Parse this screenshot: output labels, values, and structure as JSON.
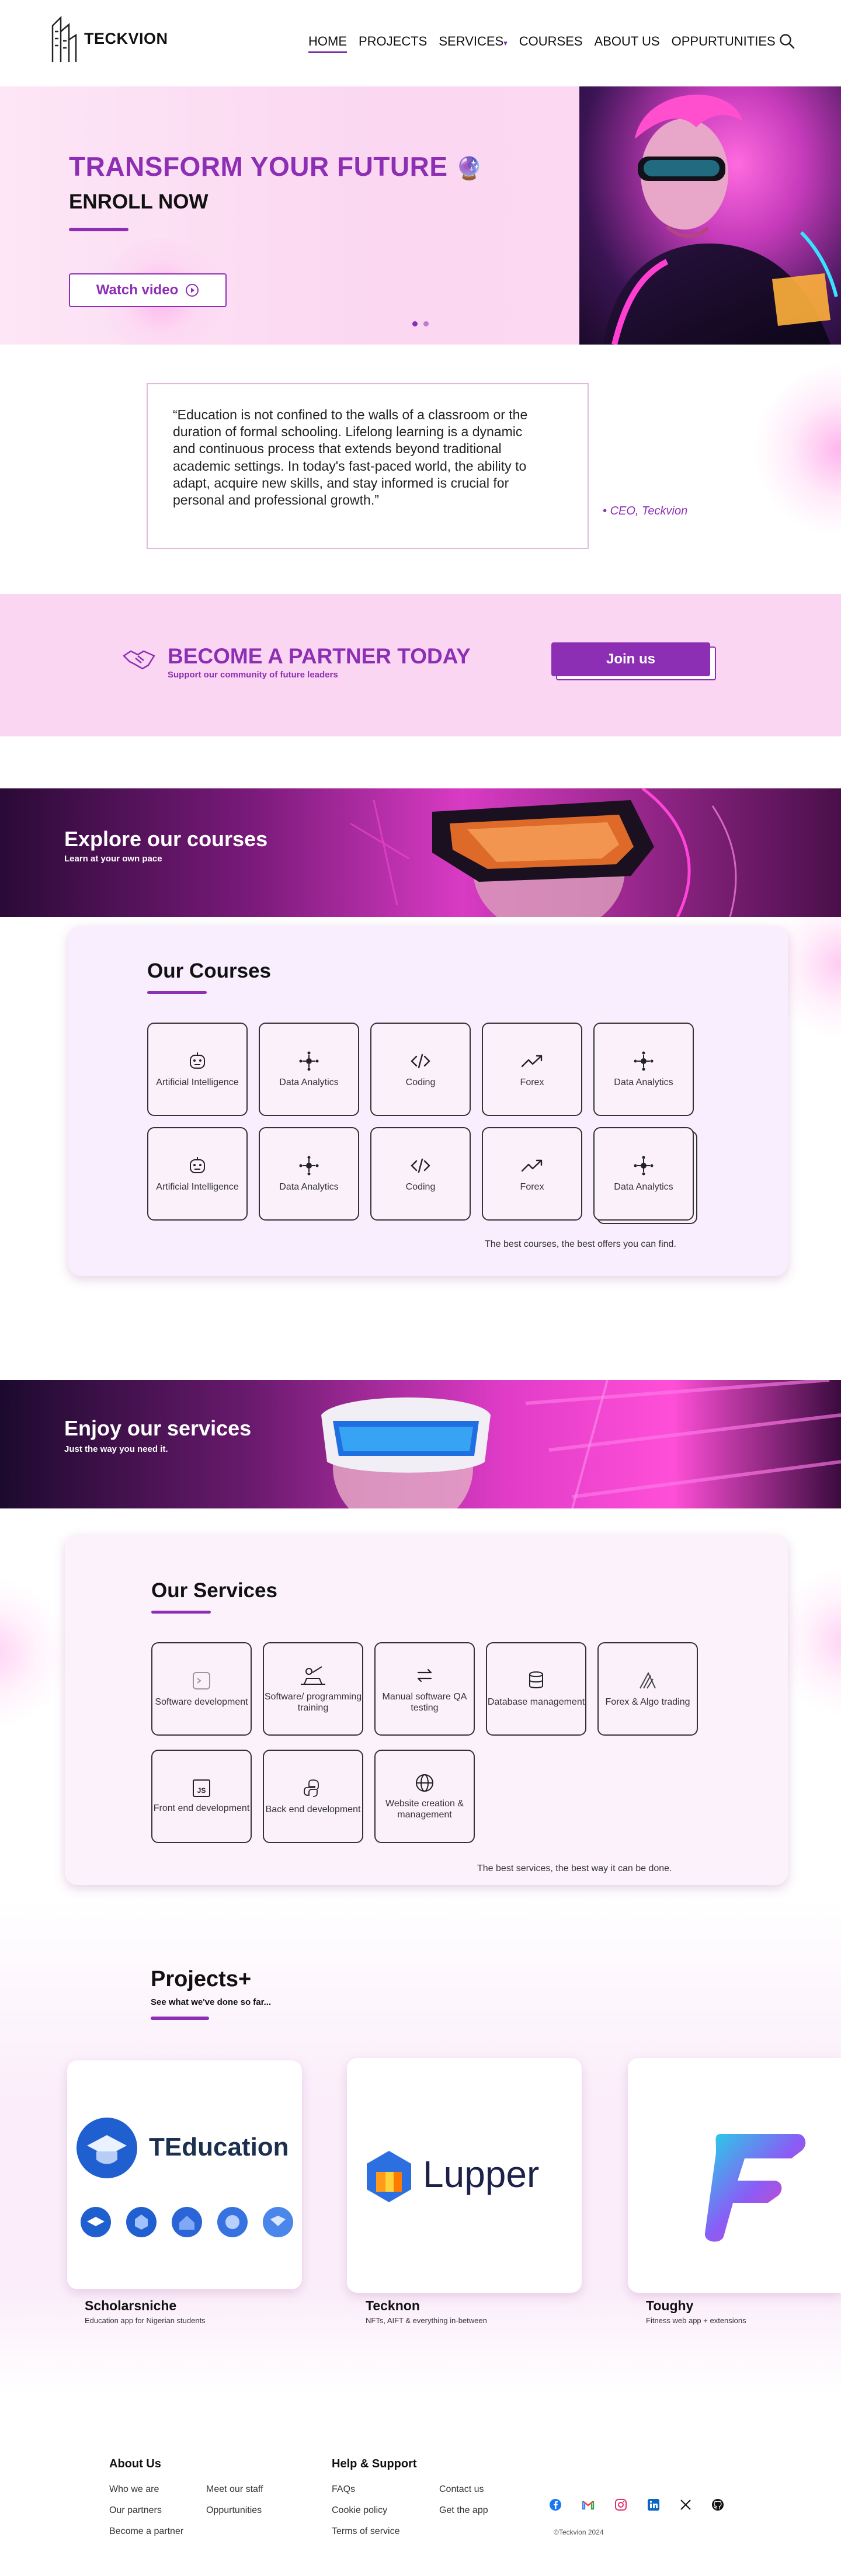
{
  "nav": {
    "brand": "TECKVION",
    "items": [
      {
        "label": "HOME",
        "active": true
      },
      {
        "label": "PROJECTS"
      },
      {
        "label": "SERVICES",
        "dropdown": true
      },
      {
        "label": "COURSES"
      },
      {
        "label": "ABOUT US"
      },
      {
        "label": "OPPURTUNITIES"
      }
    ],
    "search_icon": "search-icon"
  },
  "hero": {
    "title": "TRANSFORM YOUR FUTURE",
    "subtitle": "ENROLL NOW",
    "watch_label": "Watch video",
    "emoji": "🔮"
  },
  "quote": {
    "text": "“Education is not confined to the walls of a classroom or the duration of formal schooling. Lifelong learning is a dynamic and continuous process that extends beyond traditional academic settings. In today's fast-paced world, the ability to adapt, acquire new skills, and stay informed is crucial for personal and professional growth.”",
    "author": "CEO, Teckvion"
  },
  "partner": {
    "title": "BECOME A PARTNER TODAY",
    "subtitle": "Support our community of future leaders",
    "button": "Join us"
  },
  "courses_banner": {
    "title": "Explore our courses",
    "subtitle": "Learn at your own pace"
  },
  "courses": {
    "heading": "Our Courses",
    "caption": "The best courses, the best offers you can find.",
    "items": [
      {
        "label": "Artificial Intelligence",
        "icon": "robot-icon"
      },
      {
        "label": "Data Analytics",
        "icon": "data-node-icon"
      },
      {
        "label": "Coding",
        "icon": "code-icon"
      },
      {
        "label": "Forex",
        "icon": "trend-up-icon"
      },
      {
        "label": "Data Analytics",
        "icon": "data-node-icon"
      },
      {
        "label": "Artificial Intelligence",
        "icon": "robot-icon"
      },
      {
        "label": "Data Analytics",
        "icon": "data-node-icon"
      },
      {
        "label": "Coding",
        "icon": "code-icon"
      },
      {
        "label": "Forex",
        "icon": "trend-up-icon"
      },
      {
        "label": "Data Analytics",
        "icon": "data-node-icon"
      }
    ]
  },
  "services_banner": {
    "title": "Enjoy our services",
    "subtitle": "Just the way you need it."
  },
  "services": {
    "heading": "Our Services",
    "caption": "The best services, the best way it can be done.",
    "items": [
      {
        "label": "Software development",
        "icon": "terminal-icon"
      },
      {
        "label": "Software/ programming training",
        "icon": "training-icon"
      },
      {
        "label": "Manual software QA testing",
        "icon": "qa-arrows-icon"
      },
      {
        "label": "Database management",
        "icon": "database-icon"
      },
      {
        "label": "Forex & Algo trading",
        "icon": "trading-icon"
      },
      {
        "label": "Front end development",
        "icon": "js-icon"
      },
      {
        "label": "Back end development",
        "icon": "python-icon"
      },
      {
        "label": "Website creation & management",
        "icon": "globe-icon"
      }
    ]
  },
  "projects": {
    "heading": "Projects+",
    "subheading": "See what we've done so far...",
    "items": [
      {
        "name": "Scholarsniche",
        "desc": "Education app for Nigerian students",
        "logo_text": "TEducation"
      },
      {
        "name": "Tecknon",
        "desc": "NFTs, AIFT & everything in-between",
        "logo_text": "Lupper"
      },
      {
        "name": "Toughy",
        "desc": "Fitness web app + extensions",
        "logo_text": ""
      }
    ]
  },
  "footer": {
    "about_heading": "About Us",
    "about_links": [
      "Who we are",
      "Meet our staff",
      "Our partners",
      "Oppurtunities",
      "Become a partner"
    ],
    "help_heading": "Help & Support",
    "help_links": [
      "FAQs",
      "Contact us",
      "Cookie policy",
      "Get the app",
      "Terms of service"
    ],
    "socials": [
      "facebook-icon",
      "gmail-icon",
      "instagram-icon",
      "linkedin-icon",
      "x-icon",
      "github-icon"
    ],
    "copyright": "©Teckvion 2024"
  },
  "colors": {
    "accent": "#8d2fb4",
    "pink_bg": "#fbd6f2",
    "panel_bg": "#f8eefd"
  }
}
